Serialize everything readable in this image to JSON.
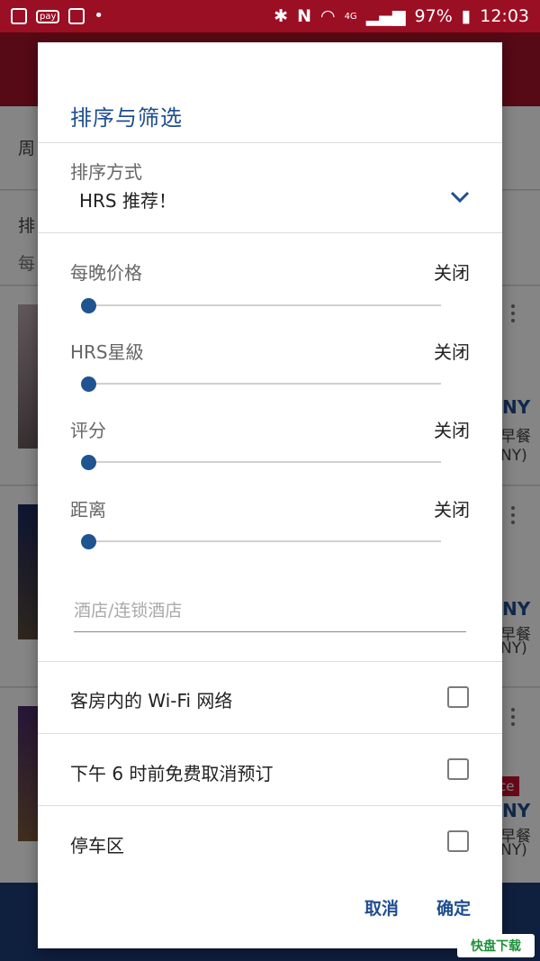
{
  "status_bar": {
    "battery": "97%",
    "time": "12:03",
    "network": "4G"
  },
  "background": {
    "row1_text": "周",
    "row2_text": "排",
    "row2_sub": "每",
    "price_fragment_1": "NY",
    "breakfast_1": "早餐",
    "paren_1": "NY)",
    "price_fragment_2": "NY",
    "breakfast_2": "早餐",
    "paren_2": "NY)",
    "badge_fragment": "ce",
    "price_fragment_3": "NY",
    "breakfast_3": "早餐",
    "paren_3": "NY)"
  },
  "dialog": {
    "title": "排序与筛选",
    "sort": {
      "label": "排序方式",
      "value": "HRS 推荐！"
    },
    "filters": [
      {
        "label": "每晚价格",
        "status": "关闭",
        "value": 0
      },
      {
        "label": "HRS星級",
        "status": "关闭",
        "value": 0
      },
      {
        "label": "评分",
        "status": "关闭",
        "value": 0
      },
      {
        "label": "距离",
        "status": "关闭",
        "value": 0
      }
    ],
    "hotel_search": {
      "placeholder": "酒店/连锁酒店",
      "value": ""
    },
    "checkboxes": [
      {
        "label": "客房内的 Wi-Fi 网络",
        "checked": false
      },
      {
        "label": "下午 6 时前免费取消预订",
        "checked": false
      },
      {
        "label": "停车区",
        "checked": false
      }
    ],
    "cancel_label": "取消",
    "confirm_label": "确定"
  },
  "colors": {
    "brand_red": "#a4142a",
    "accent_blue": "#1f4f8f"
  },
  "watermark": "快盘下载"
}
